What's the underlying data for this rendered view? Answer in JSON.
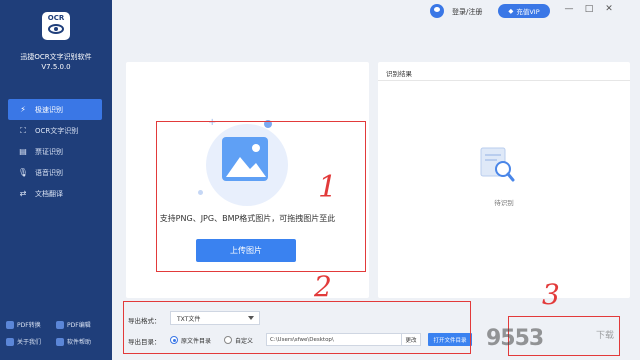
{
  "app": {
    "logo_text": "OCR",
    "name": "迅捷OCR文字识别软件",
    "version": "V7.5.0.0"
  },
  "nav": {
    "items": [
      {
        "label": "极速识别",
        "icon": "lightning-icon",
        "active": true
      },
      {
        "label": "OCR文字识别",
        "icon": "scan-icon",
        "active": false
      },
      {
        "label": "票证识别",
        "icon": "ticket-icon",
        "active": false
      },
      {
        "label": "语音识别",
        "icon": "microphone-icon",
        "active": false
      },
      {
        "label": "文档翻译",
        "icon": "translate-icon",
        "active": false
      }
    ]
  },
  "bottom_links": {
    "pdf_convert": "PDF转换",
    "pdf_edit": "PDF编辑",
    "about": "关于我们",
    "help": "软件帮助"
  },
  "topbar": {
    "login": "登录/注册",
    "vip": "充值VIP",
    "controls": [
      "—",
      "□",
      "✕"
    ]
  },
  "upload": {
    "support_text": "支持PNG、JPG、BMP格式图片，可拖拽图片至此",
    "button": "上传图片"
  },
  "result": {
    "title": "识别结果",
    "pending": "待识别"
  },
  "export": {
    "format_label": "导出格式：",
    "format_value": "TXT文件",
    "dir_label": "导出目录：",
    "radio_source": "原文件目录",
    "radio_custom": "自定义",
    "path": "C:\\Users\\sfwe\\Desktop\\",
    "change": "更改",
    "open_dir": "打开文件目录"
  },
  "annotations": [
    "1",
    "2",
    "3"
  ],
  "watermark": {
    "main": "9553",
    "side": "下载"
  },
  "colors": {
    "sidebar": "#1f3e7a",
    "accent": "#3a77e6",
    "annotation": "#e23a3a"
  }
}
